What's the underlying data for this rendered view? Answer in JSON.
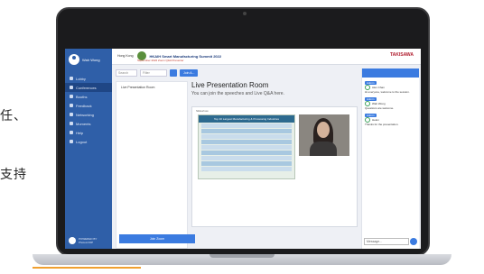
{
  "side_text": {
    "left_1": "任、",
    "left_2": "支持"
  },
  "user": {
    "name": "Wah Wong"
  },
  "nav": {
    "items": [
      {
        "label": "Lobby"
      },
      {
        "label": "Conferences"
      },
      {
        "label": "Booths"
      },
      {
        "label": "Feedback"
      },
      {
        "label": "Networking"
      },
      {
        "label": "Moments"
      },
      {
        "label": "Help"
      },
      {
        "label": "Logout"
      }
    ],
    "active_index": 1
  },
  "powered": {
    "label": "POWERED BY",
    "brand": "PhotoLOOP"
  },
  "banner": {
    "org": "Hong Kong",
    "title": "HKAIH Smart Manufacturing Summit 2022",
    "subtitle": "September 2022 Zoom Q&A Presenter",
    "sponsor": "TAKISAWA"
  },
  "toolbar": {
    "search_placeholder": "Search",
    "filter_label": "Filter",
    "room_button": "Join A..."
  },
  "sessions": {
    "items": [
      "Live Presentation Room"
    ]
  },
  "room": {
    "title": "Live Presentation Room",
    "subtitle": "You can join the speeches and Live Q&A here.",
    "video_label": "Slideshow",
    "slide_title": "Top 10 Largest Manufacturing & Processing Industries",
    "join_label": "Join Zoom"
  },
  "chat": {
    "messages": [
      {
        "tag": "Admin",
        "author": "Alex Chan",
        "text": "Hi everyone, welcome to the session."
      },
      {
        "tag": "Admin",
        "author": "Wah Wong",
        "text": "Questions are welcome."
      },
      {
        "tag": "Admin",
        "author": "Helen",
        "text": "Thanks for the presentation."
      }
    ],
    "input_placeholder": "Message..."
  }
}
